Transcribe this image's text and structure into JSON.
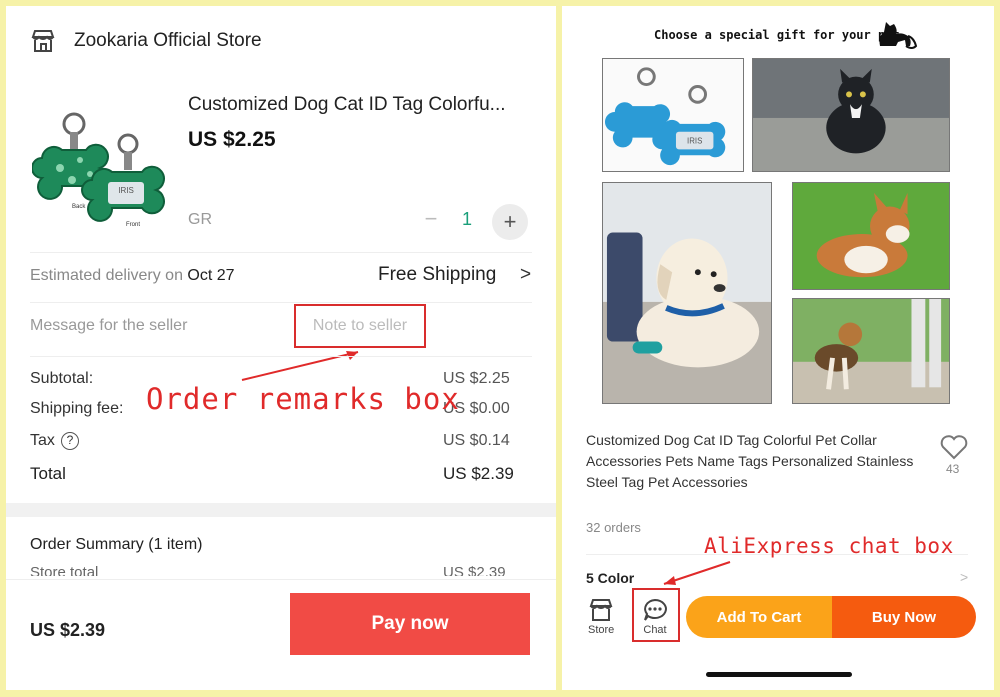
{
  "checkout": {
    "store_name": "Zookaria Official Store",
    "product_title": "Customized Dog Cat ID Tag Colorfu...",
    "product_price": "US $2.25",
    "variant": "GR",
    "quantity": "1",
    "qty_minus": "−",
    "qty_plus": "+",
    "delivery_prefix": "Estimated delivery on",
    "delivery_date": "Oct 27",
    "shipping_label": "Free Shipping",
    "shipping_chevron": ">",
    "message_label": "Message for the seller",
    "note_placeholder": "Note to seller",
    "subtotal_label": "Subtotal:",
    "subtotal_value": "US $2.25",
    "shipping_fee_label": "Shipping fee:",
    "shipping_fee_value": "US $0.00",
    "tax_label": "Tax",
    "tax_help": "?",
    "tax_value": "US $0.14",
    "total_label": "Total",
    "total_value": "US $2.39",
    "summary_title": "Order Summary (1 item)",
    "store_total_label": "Store total",
    "store_total_value": "US $2.39",
    "bottom_total": "US $2.39",
    "pay_button": "Pay now",
    "annotation": "Order remarks box",
    "tag_text": "IRIS",
    "tag_back_label": "Back",
    "tag_front_label": "Front"
  },
  "product_page": {
    "banner": "Choose a special gift for your pet",
    "title": "Customized Dog Cat ID Tag Colorful Pet Collar Accessories Pets Name Tags Personalized Stainless Steel Tag Pet  Accessories",
    "likes": "43",
    "orders": "32 orders",
    "annotation": "AliExpress chat box",
    "color_label": "5 Color",
    "color_chevron": ">",
    "tab_store": "Store",
    "tab_chat": "Chat",
    "add_to_cart": "Add To Cart",
    "buy_now": "Buy Now",
    "tag_text": "IRIS"
  },
  "colors": {
    "pay_button": "#f14b45",
    "annotation_red": "#e02a2a",
    "add_to_cart": "#fba319",
    "buy_now": "#f55b0f",
    "qty_accent": "#1a9f7a",
    "frame": "#f6f2a8"
  },
  "icons": {
    "store": "store-icon",
    "heart": "heart-icon",
    "chat": "chat-bubble-icon",
    "dog": "dog-silhouette-icon"
  }
}
